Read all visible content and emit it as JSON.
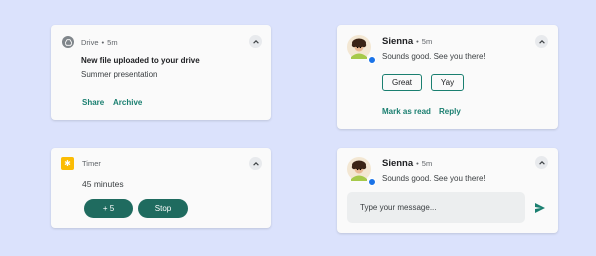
{
  "drive": {
    "app": "Drive",
    "time": "5m",
    "title": "New file uploaded to your drive",
    "body": "Summer presentation",
    "actions": [
      "Share",
      "Archive"
    ]
  },
  "sienna_reply": {
    "sender": "Sienna",
    "time": "5m",
    "message": "Sounds good. See you there!",
    "smart_replies": [
      "Great",
      "Yay"
    ],
    "actions": [
      "Mark as read",
      "Reply"
    ]
  },
  "timer": {
    "app": "Timer",
    "remaining": "45 minutes",
    "buttons": [
      "+ 5",
      "Stop"
    ]
  },
  "sienna_input": {
    "sender": "Sienna",
    "time": "5m",
    "message": "Sounds good. See you there!",
    "input_placeholder": "Type your message..."
  },
  "colors": {
    "background": "#dbe2fc",
    "accent": "#1a7f70",
    "pill": "#1f6b5f",
    "timer_icon": "#fbbc04"
  },
  "icons": {
    "drive": "drive-icon",
    "timer": "timer-icon",
    "send": "send-icon",
    "expand": "chevron-up-icon"
  }
}
